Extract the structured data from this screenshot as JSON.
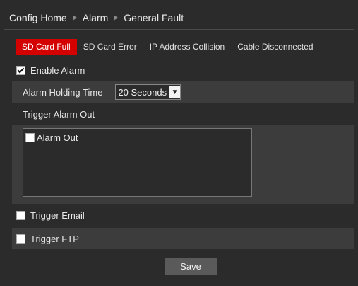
{
  "breadcrumb": [
    "Config Home",
    "Alarm",
    "General Fault"
  ],
  "tabs": [
    "SD Card Full",
    "SD Card Error",
    "IP Address Collision",
    "Cable Disconnected"
  ],
  "enable_alarm": {
    "label": "Enable Alarm",
    "checked": true
  },
  "holding_time": {
    "label": "Alarm Holding Time",
    "value": "20 Seconds"
  },
  "trigger_alarm_out": {
    "label": "Trigger Alarm Out",
    "items": [
      {
        "label": "Alarm Out",
        "checked": false
      }
    ]
  },
  "trigger_email": {
    "label": "Trigger Email",
    "checked": false
  },
  "trigger_ftp": {
    "label": "Trigger FTP",
    "checked": false
  },
  "save_label": "Save",
  "colors": {
    "active_tab": "#d40000",
    "background": "#2b2b2b",
    "row_alt": "#3c3c3c"
  }
}
